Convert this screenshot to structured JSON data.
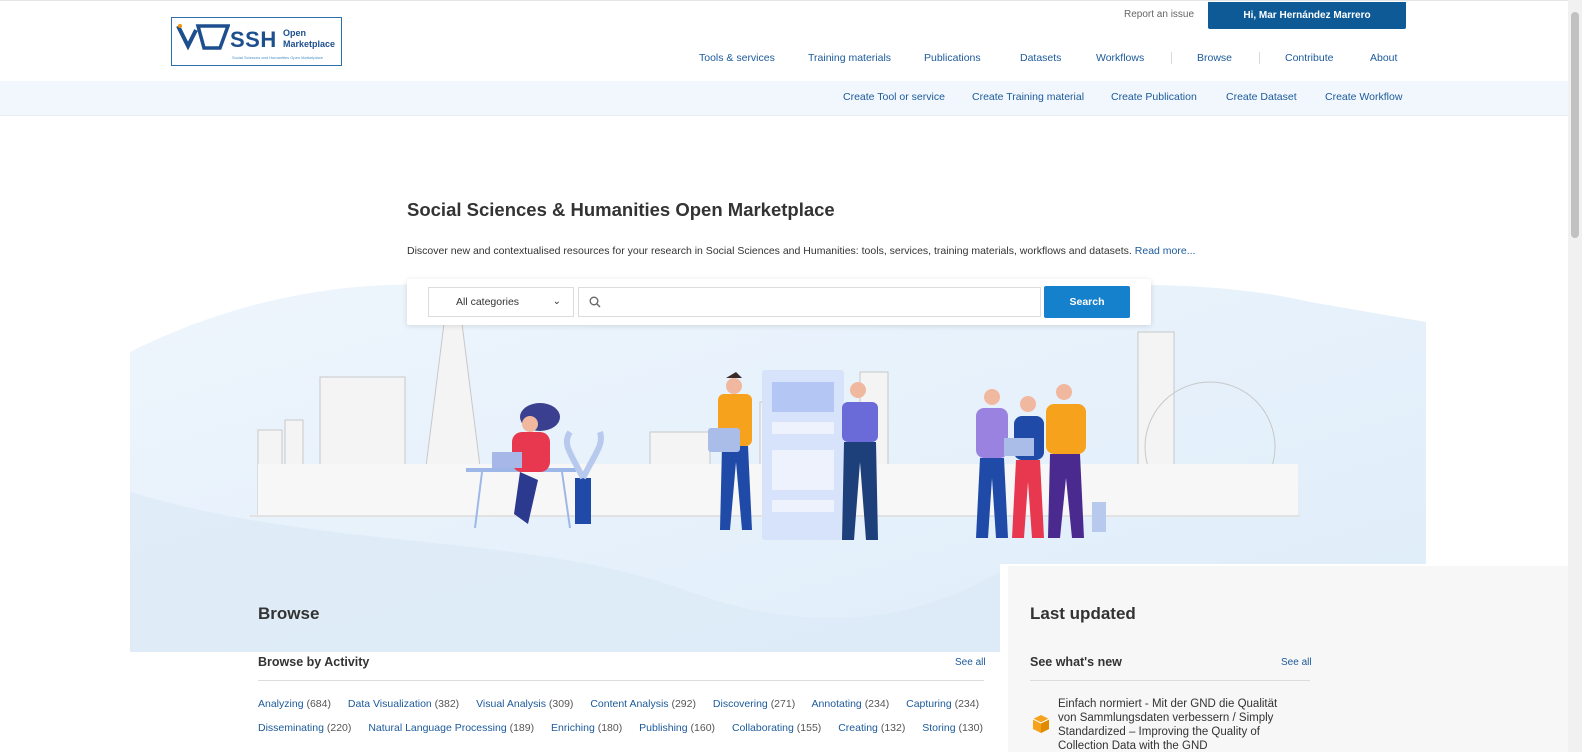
{
  "header": {
    "logo": {
      "main": "SSH",
      "sub1": "Open",
      "sub2": "Marketplace",
      "tagline": "Social Sciences and Humanities Open Marketplace"
    },
    "report_issue": "Report an issue",
    "user_button": "Hi, Mar Hernández Marrero",
    "nav": [
      "Tools & services",
      "Training materials",
      "Publications",
      "Datasets",
      "Workflows",
      "Browse",
      "Contribute",
      "About"
    ]
  },
  "subnav": [
    "Create Tool or service",
    "Create Training material",
    "Create Publication",
    "Create Dataset",
    "Create Workflow"
  ],
  "hero": {
    "title": "Social Sciences & Humanities Open Marketplace",
    "intro": "Discover new and contextualised resources for your research in Social Sciences and Humanities: tools, services, training materials, workflows and datasets.",
    "read_more": "Read more...",
    "category_select": "All categories",
    "search_button": "Search",
    "search_placeholder": ""
  },
  "browse": {
    "title": "Browse",
    "subtitle": "Browse by Activity",
    "see_all": "See all",
    "activities": [
      {
        "label": "Analyzing",
        "count": "(684)"
      },
      {
        "label": "Data Visualization",
        "count": "(382)"
      },
      {
        "label": "Visual Analysis",
        "count": "(309)"
      },
      {
        "label": "Content Analysis",
        "count": "(292)"
      },
      {
        "label": "Discovering",
        "count": "(271)"
      },
      {
        "label": "Annotating",
        "count": "(234)"
      },
      {
        "label": "Capturing",
        "count": "(234)"
      },
      {
        "label": "Disseminating",
        "count": "(220)"
      },
      {
        "label": "Natural Language Processing",
        "count": "(189)"
      },
      {
        "label": "Enriching",
        "count": "(180)"
      },
      {
        "label": "Publishing",
        "count": "(160)"
      },
      {
        "label": "Collaborating",
        "count": "(155)"
      },
      {
        "label": "Creating",
        "count": "(132)"
      },
      {
        "label": "Storing",
        "count": "(130)"
      }
    ]
  },
  "last_updated": {
    "title": "Last updated",
    "subtitle": "See what's new",
    "see_all": "See all",
    "item": "Einfach normiert - Mit der GND die Qualität von Sammlungsdaten verbessern / Simply Standardized – Improving the Quality of Collection Data with the GND"
  },
  "colors": {
    "brand": "#0d5a96",
    "link": "#1c5a9a",
    "search_button": "#1580cc"
  }
}
